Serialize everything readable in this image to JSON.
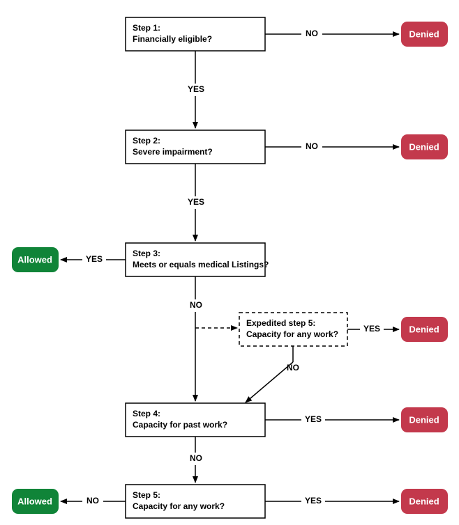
{
  "nodes": {
    "step1": {
      "title": "Step 1:",
      "sub": "Financially eligible?"
    },
    "step2": {
      "title": "Step 2:",
      "sub": "Severe impairment?"
    },
    "step3": {
      "title": "Step 3:",
      "sub": "Meets or equals medical Listings?"
    },
    "step4": {
      "title": "Step 4:",
      "sub": "Capacity for past work?"
    },
    "step5": {
      "title": "Step 5:",
      "sub": "Capacity for any work?"
    },
    "expedited": {
      "title": "Expedited step 5:",
      "sub": "Capacity for any work?"
    }
  },
  "terminals": {
    "denied": "Denied",
    "allowed": "Allowed"
  },
  "labels": {
    "yes": "YES",
    "no": "NO"
  }
}
